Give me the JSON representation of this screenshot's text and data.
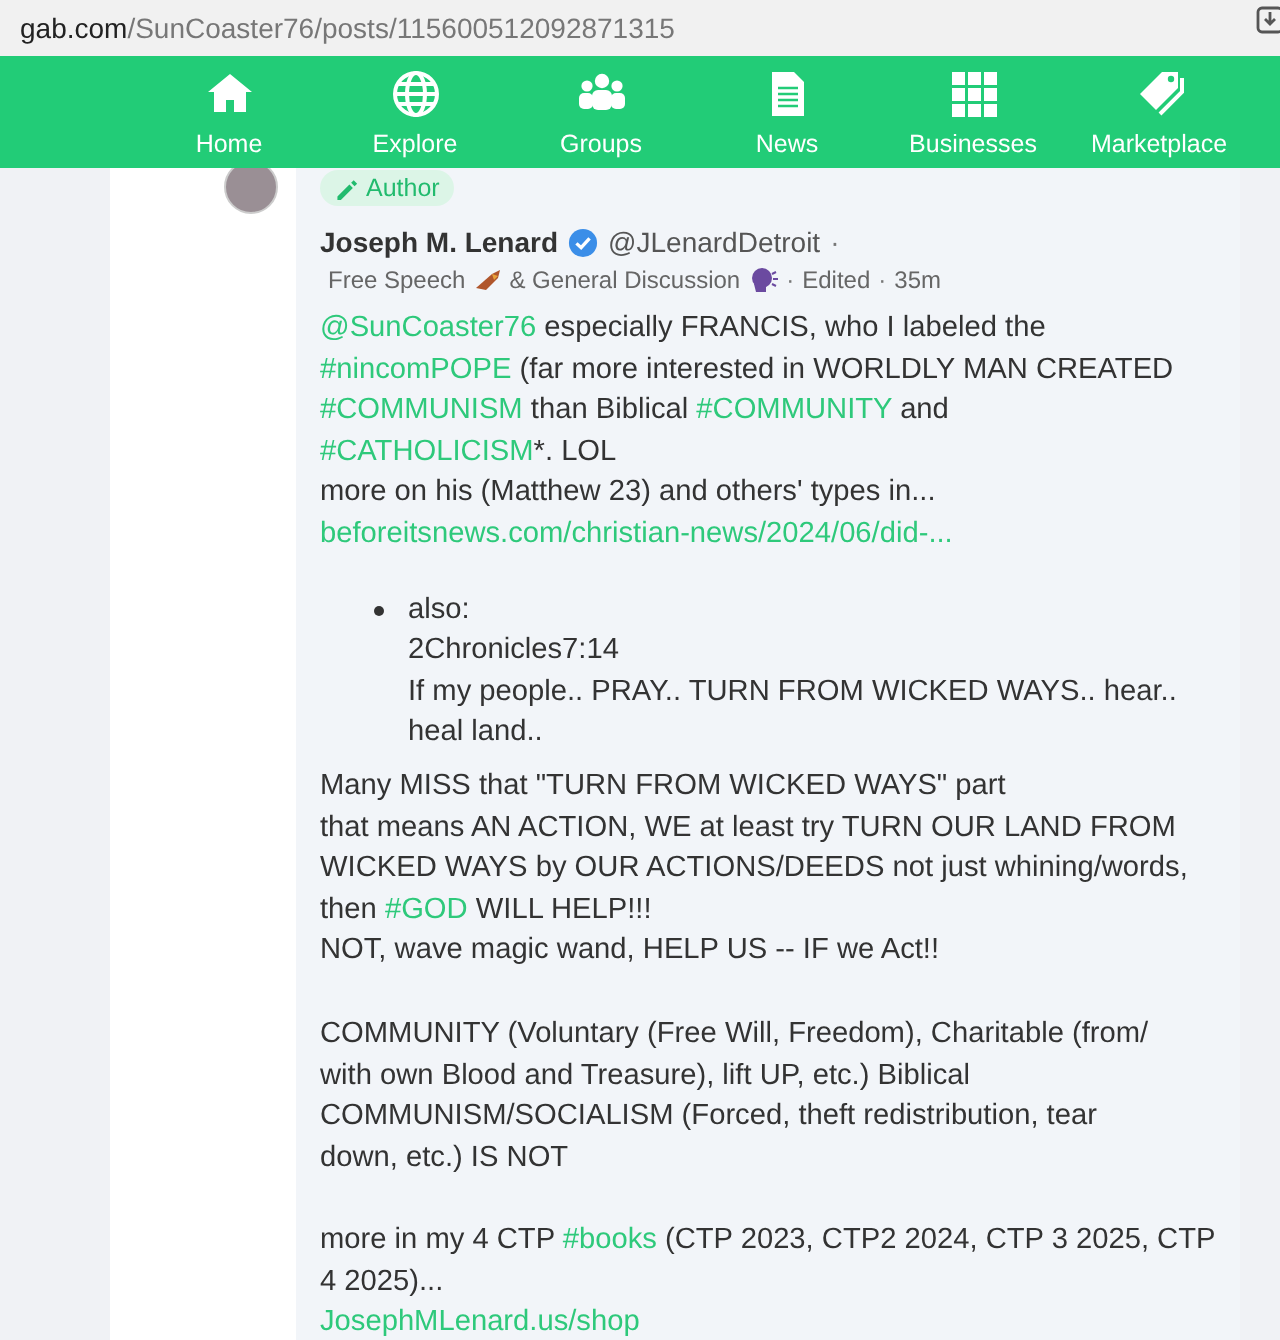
{
  "address_bar": {
    "domain": "gab.com",
    "path": "/SunCoaster76/posts/115600512092871315"
  },
  "nav": [
    {
      "label": "Home",
      "kind": "home"
    },
    {
      "label": "Explore",
      "kind": "globe"
    },
    {
      "label": "Groups",
      "kind": "people"
    },
    {
      "label": "News",
      "kind": "document"
    },
    {
      "label": "Businesses",
      "kind": "grid"
    },
    {
      "label": "Marketplace",
      "kind": "tags"
    }
  ],
  "post": {
    "badge": "Author",
    "author": {
      "name": "Joseph M. Lenard",
      "verified": true,
      "handle": "@JLenardDetroit",
      "separator": "·"
    },
    "meta": {
      "group_1": "Free Speech",
      "group_2": "& General Discussion",
      "edited": "Edited",
      "time": "35m",
      "separator": "·"
    },
    "body": [
      {
        "kind": "paragraph",
        "lines": [
          [
            {
              "kind": "mention",
              "text": "@SunCoaster76"
            },
            {
              "kind": "text",
              "text": " especially FRANCIS, who I labeled the"
            }
          ],
          [
            {
              "kind": "hashtag",
              "text": "#nincomPOPE"
            },
            {
              "kind": "text",
              "text": " (far more interested in WORLDLY MAN CREATED"
            }
          ],
          [
            {
              "kind": "hashtag",
              "text": "#COMMUNISM"
            },
            {
              "kind": "text",
              "text": " than Biblical "
            },
            {
              "kind": "hashtag",
              "text": "#COMMUNITY"
            },
            {
              "kind": "text",
              "text": " and"
            }
          ],
          [
            {
              "kind": "hashtag",
              "text": "#CATHOLICISM"
            },
            {
              "kind": "text",
              "text": "*. LOL"
            }
          ],
          [
            {
              "kind": "text",
              "text": "more on his (Matthew 23) and others' types in..."
            }
          ],
          [
            {
              "kind": "url",
              "text": "beforeitsnews.com/christian-news/2024/06/did-..."
            }
          ]
        ]
      },
      {
        "kind": "list",
        "items": [
          {
            "lines": [
              [
                {
                  "kind": "text",
                  "text": "also:"
                }
              ],
              [
                {
                  "kind": "text",
                  "text": "2Chronicles7:14"
                }
              ],
              [
                {
                  "kind": "text",
                  "text": "If my people.. PRAY.. TURN FROM WICKED WAYS.. hear.."
                }
              ],
              [
                {
                  "kind": "text",
                  "text": "heal land.."
                }
              ]
            ]
          }
        ]
      },
      {
        "kind": "paragraph",
        "lines": [
          [
            {
              "kind": "text",
              "text": "Many MISS that \"TURN FROM WICKED WAYS\" part"
            }
          ],
          [
            {
              "kind": "text",
              "text": "that means AN ACTION, WE at least try TURN OUR LAND FROM"
            }
          ],
          [
            {
              "kind": "text",
              "text": "WICKED WAYS by OUR ACTIONS/DEEDS not just whining/words,"
            }
          ],
          [
            {
              "kind": "text",
              "text": "then "
            },
            {
              "kind": "hashtag",
              "text": "#GOD"
            },
            {
              "kind": "text",
              "text": " WILL HELP!!!"
            }
          ],
          [
            {
              "kind": "text",
              "text": "NOT, wave magic wand, HELP US -- IF we Act!!"
            }
          ]
        ]
      },
      {
        "kind": "paragraph",
        "lines": [
          [
            {
              "kind": "text",
              "text": "COMMUNITY (Voluntary (Free Will, Freedom), Charitable (from/"
            }
          ],
          [
            {
              "kind": "text",
              "text": "with own Blood and Treasure), lift UP, etc.) Biblical"
            }
          ],
          [
            {
              "kind": "text",
              "text": "COMMUNISM/SOCIALISM (Forced, theft redistribution, tear"
            }
          ],
          [
            {
              "kind": "text",
              "text": "down, etc.) IS NOT"
            }
          ]
        ]
      },
      {
        "kind": "paragraph",
        "lines": [
          [
            {
              "kind": "text",
              "text": "more in my 4 CTP "
            },
            {
              "kind": "hashtag",
              "text": "#books"
            },
            {
              "kind": "text",
              "text": " (CTP 2023, CTP2 2024, CTP 3 2025, CTP"
            }
          ],
          [
            {
              "kind": "text",
              "text": "4 2025)..."
            }
          ],
          [
            {
              "kind": "url",
              "text": "JosephMLenard.us/shop"
            }
          ]
        ]
      }
    ]
  }
}
